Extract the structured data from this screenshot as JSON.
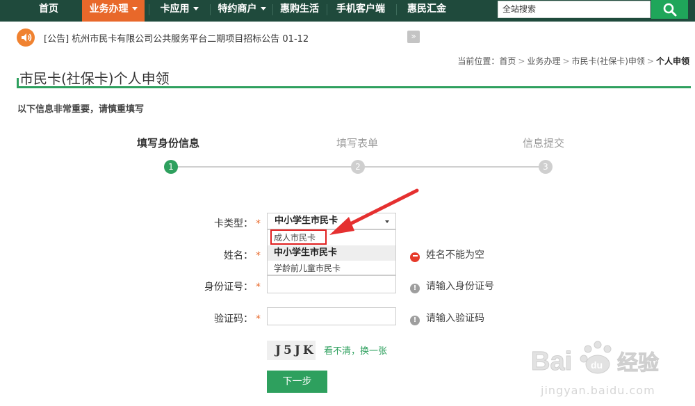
{
  "nav": {
    "items": [
      {
        "label": "首页"
      },
      {
        "label": "业务办理"
      },
      {
        "label": "卡应用"
      },
      {
        "label": "特约商户"
      },
      {
        "label": "惠购生活"
      },
      {
        "label": "手机客户端"
      },
      {
        "label": "惠民汇金"
      }
    ],
    "search_value": "全站搜索"
  },
  "notice": {
    "text": "[公告] 杭州市民卡有限公司公共服务平台二期项目招标公告 01-12",
    "more": "»"
  },
  "breadcrumb": {
    "prefix": "当前位置：",
    "items": [
      "首页",
      "业务办理",
      "市民卡(社保卡)申领"
    ],
    "current": "个人申领",
    "separator": ">"
  },
  "page": {
    "title": "市民卡(社保卡)个人申领",
    "note": "以下信息非常重要，请慎重填写"
  },
  "steps": [
    {
      "label": "填写身份信息",
      "num": "1",
      "status": "done"
    },
    {
      "label": "填写表单",
      "num": "2",
      "status": "pending"
    },
    {
      "label": "信息提交",
      "num": "3",
      "status": "pending"
    }
  ],
  "form": {
    "card_type": {
      "label": "卡类型：",
      "star": "*",
      "value": "中小学生市民卡",
      "options": [
        "成人市民卡",
        "中小学生市民卡",
        "学龄前儿童市民卡"
      ]
    },
    "name": {
      "label": "姓名：",
      "star": "*",
      "value": "",
      "hint": "姓名不能为空"
    },
    "id_number": {
      "label": "身份证号：",
      "star": "*",
      "value": "",
      "hint": "请输入身份证号"
    },
    "captcha": {
      "label": "验证码：",
      "star": "*",
      "value": "",
      "hint": "请输入验证码",
      "image_text": "J5JK",
      "refresh": "看不清，换一张"
    },
    "next": "下一步"
  },
  "watermark": {
    "brand": "Bai du 经验",
    "url": "jingyan.baidu.com"
  },
  "colors": {
    "nav_bg": "#1f4a3c",
    "accent_orange": "#e8682a",
    "brand_green": "#2ea05e",
    "error_red": "#e63a2a"
  }
}
